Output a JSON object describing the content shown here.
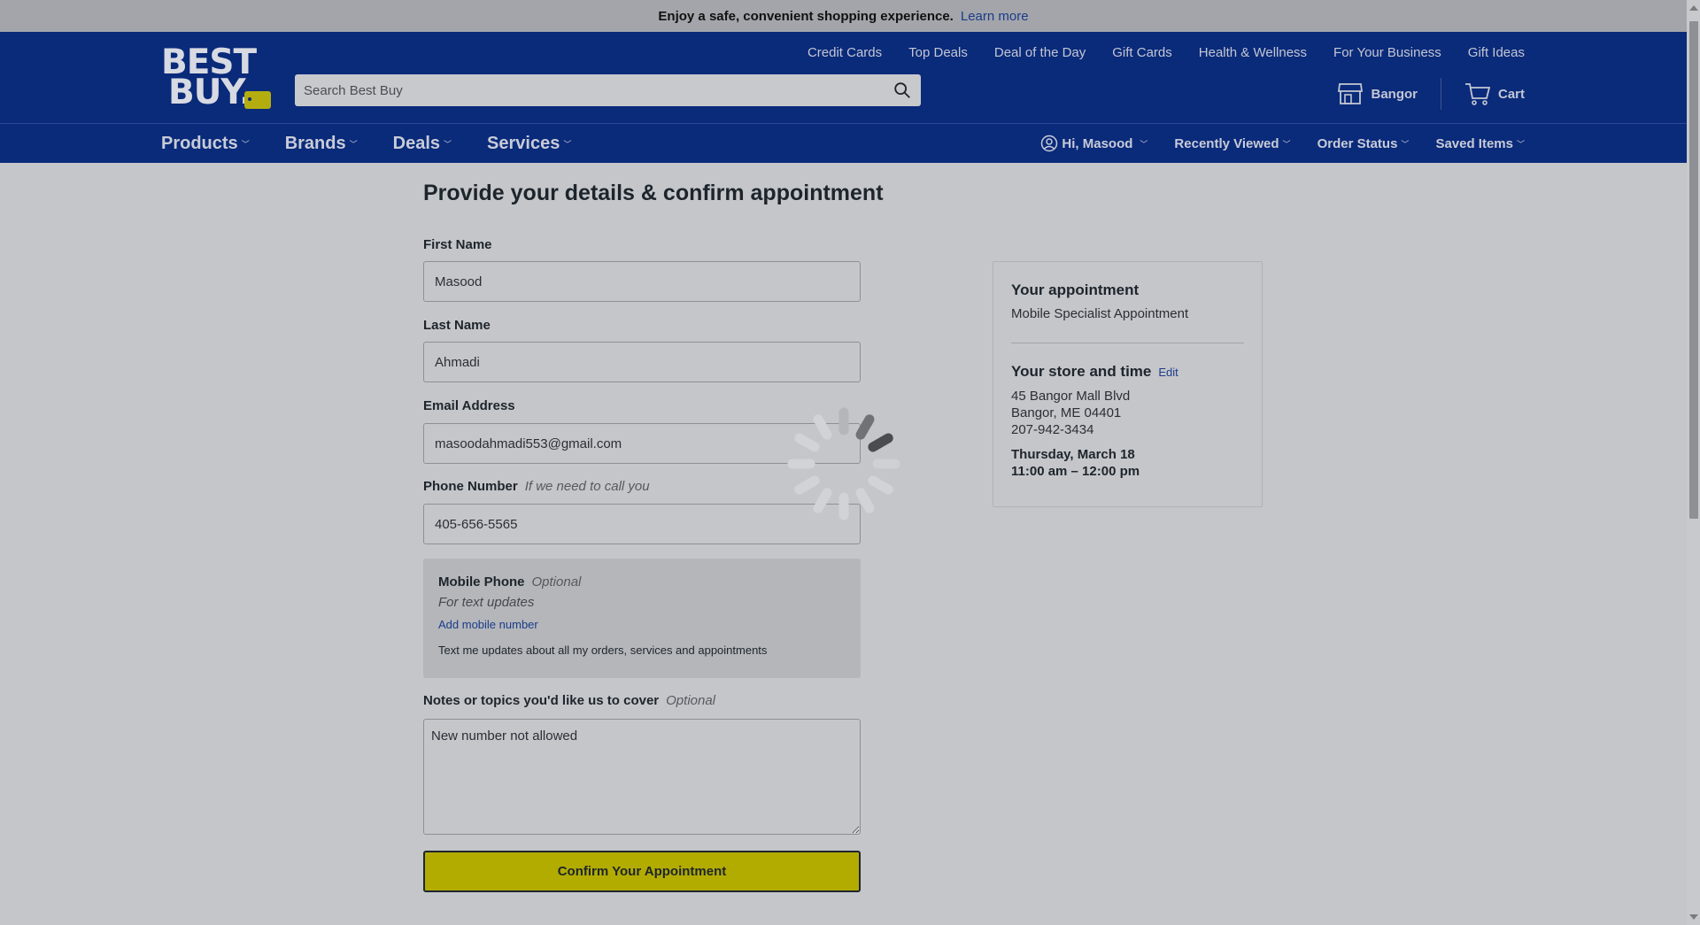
{
  "announcement": {
    "text": "Enjoy a safe, convenient shopping experience.",
    "link": "Learn more"
  },
  "header": {
    "logo_line1": "BEST",
    "logo_line2": "BUY.",
    "search_placeholder": "Search Best Buy",
    "top_links": [
      "Credit Cards",
      "Top Deals",
      "Deal of the Day",
      "Gift Cards",
      "Health & Wellness",
      "For Your Business",
      "Gift Ideas"
    ],
    "store_label": "Bangor",
    "cart_label": "Cart"
  },
  "nav": {
    "left": [
      "Products",
      "Brands",
      "Deals",
      "Services"
    ],
    "account": "Hi, Masood",
    "right": [
      "Recently Viewed",
      "Order Status",
      "Saved Items"
    ]
  },
  "form": {
    "title": "Provide your details & confirm appointment",
    "first_name_label": "First Name",
    "first_name": "Masood",
    "last_name_label": "Last Name",
    "last_name": "Ahmadi",
    "email_label": "Email Address",
    "email": "masoodahmadi553@gmail.com",
    "phone_label": "Phone Number",
    "phone_hint": "If we need to call you",
    "phone": "405-656-5565",
    "mobile_label": "Mobile Phone",
    "mobile_optional": "Optional",
    "mobile_sub": "For text updates",
    "add_mobile": "Add mobile number",
    "text_updates": "Text me updates about all my orders, services and appointments",
    "notes_label": "Notes or topics you'd like us to cover",
    "notes_optional": "Optional",
    "notes": "New number not allowed",
    "confirm_label": "Confirm Your Appointment"
  },
  "appointment": {
    "heading": "Your appointment",
    "type": "Mobile Specialist Appointment",
    "store_heading": "Your store and time",
    "edit": "Edit",
    "address1": "45 Bangor Mall Blvd",
    "address2": "Bangor, ME 04401",
    "phone": "207-942-3434",
    "date": "Thursday, March 18",
    "time": "11:00 am – 12:00 pm"
  },
  "colors": {
    "brand_blue": "#0a2a7a",
    "brand_yellow": "#b3ac00",
    "overlay_gray": "#c5c6ca"
  },
  "icons": [
    "search-icon",
    "store-icon",
    "cart-icon",
    "user-circle-icon",
    "loading-spinner-icon"
  ]
}
